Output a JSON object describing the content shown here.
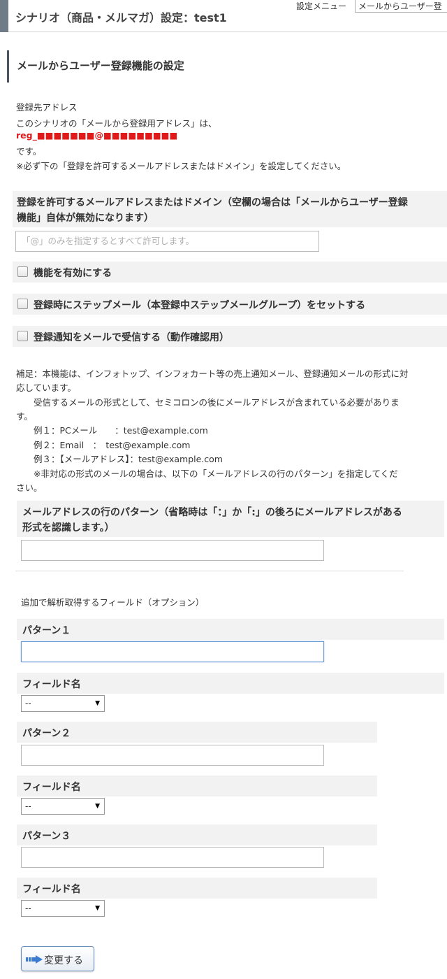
{
  "header": {
    "title": "シナリオ（商品・メルマガ）設定：test1",
    "settings_menu_label": "設定メニュー",
    "settings_menu_value": "メールからユーザー登"
  },
  "section": {
    "title": "メールからユーザー登録機能の設定"
  },
  "intro": {
    "line1": "登録先アドレス",
    "line2": "このシナリオの「メールから登録用アドレス」は、",
    "address": "reg_■■■■■■■@■■■■■■■■■",
    "line4": "です。",
    "line5": "※必ず下の「登録を許可するメールアドレスまたはドメイン」を設定してください。"
  },
  "allowed": {
    "label_line1": "登録を許可するメールアドレスまたはドメイン（空欄の場合は「メールからユーザー登録",
    "label_line2": "機能」自体が無効になります）",
    "placeholder": "「@」のみを指定するとすべて許可します。"
  },
  "checkboxes": [
    {
      "label": "機能を有効にする",
      "checked": false
    },
    {
      "label": "登録時にステップメール（本登録中ステップメールグループ）をセットする",
      "checked": false
    },
    {
      "label": "登録通知をメールで受信する（動作確認用）",
      "checked": false
    }
  ],
  "notes": {
    "line1": "補足：本機能は、インフォトップ、インフォカート等の売上通知メール、登録通知メールの形式に対",
    "line2": "応しています。",
    "line3": "　　受信するメールの形式として、セミコロンの後にメールアドレスが含まれている必要がありま",
    "line4": "す。",
    "line5": "　　例１：PCメール　　：test@example.com",
    "line6": "　　例２：Email　：　test@example.com",
    "line7": "　　例３：【メールアドレス】：test@example.com",
    "line8": "　　※非対応の形式のメールの場合は、以下の「メールアドレスの行のパターン」を指定してくだ",
    "line9": "さい。"
  },
  "pattern": {
    "label_line1": "メールアドレスの行のパターン（省略時は「：」か「:」の後ろにメールアドレスがある",
    "label_line2": "形式を認識します。）",
    "value": ""
  },
  "extra_fields": {
    "title": "追加で解析取得するフィールド（オプション）",
    "items": [
      {
        "pattern_label": "パターン１",
        "pattern_value": "",
        "field_label": "フィールド名",
        "field_value": "--"
      },
      {
        "pattern_label": "パターン２",
        "pattern_value": "",
        "field_label": "フィールド名",
        "field_value": "--"
      },
      {
        "pattern_label": "パターン３",
        "pattern_value": "",
        "field_label": "フィールド名",
        "field_value": "--"
      }
    ]
  },
  "submit": {
    "label": "変更する",
    "icon": "blue-arrow-icon"
  },
  "colors": {
    "address": "#e0191b",
    "header_bar": "#6f7b86",
    "block_bg": "#f2f2f2",
    "focus_border": "#6e9ed4",
    "button_border": "#6a8fbf"
  }
}
